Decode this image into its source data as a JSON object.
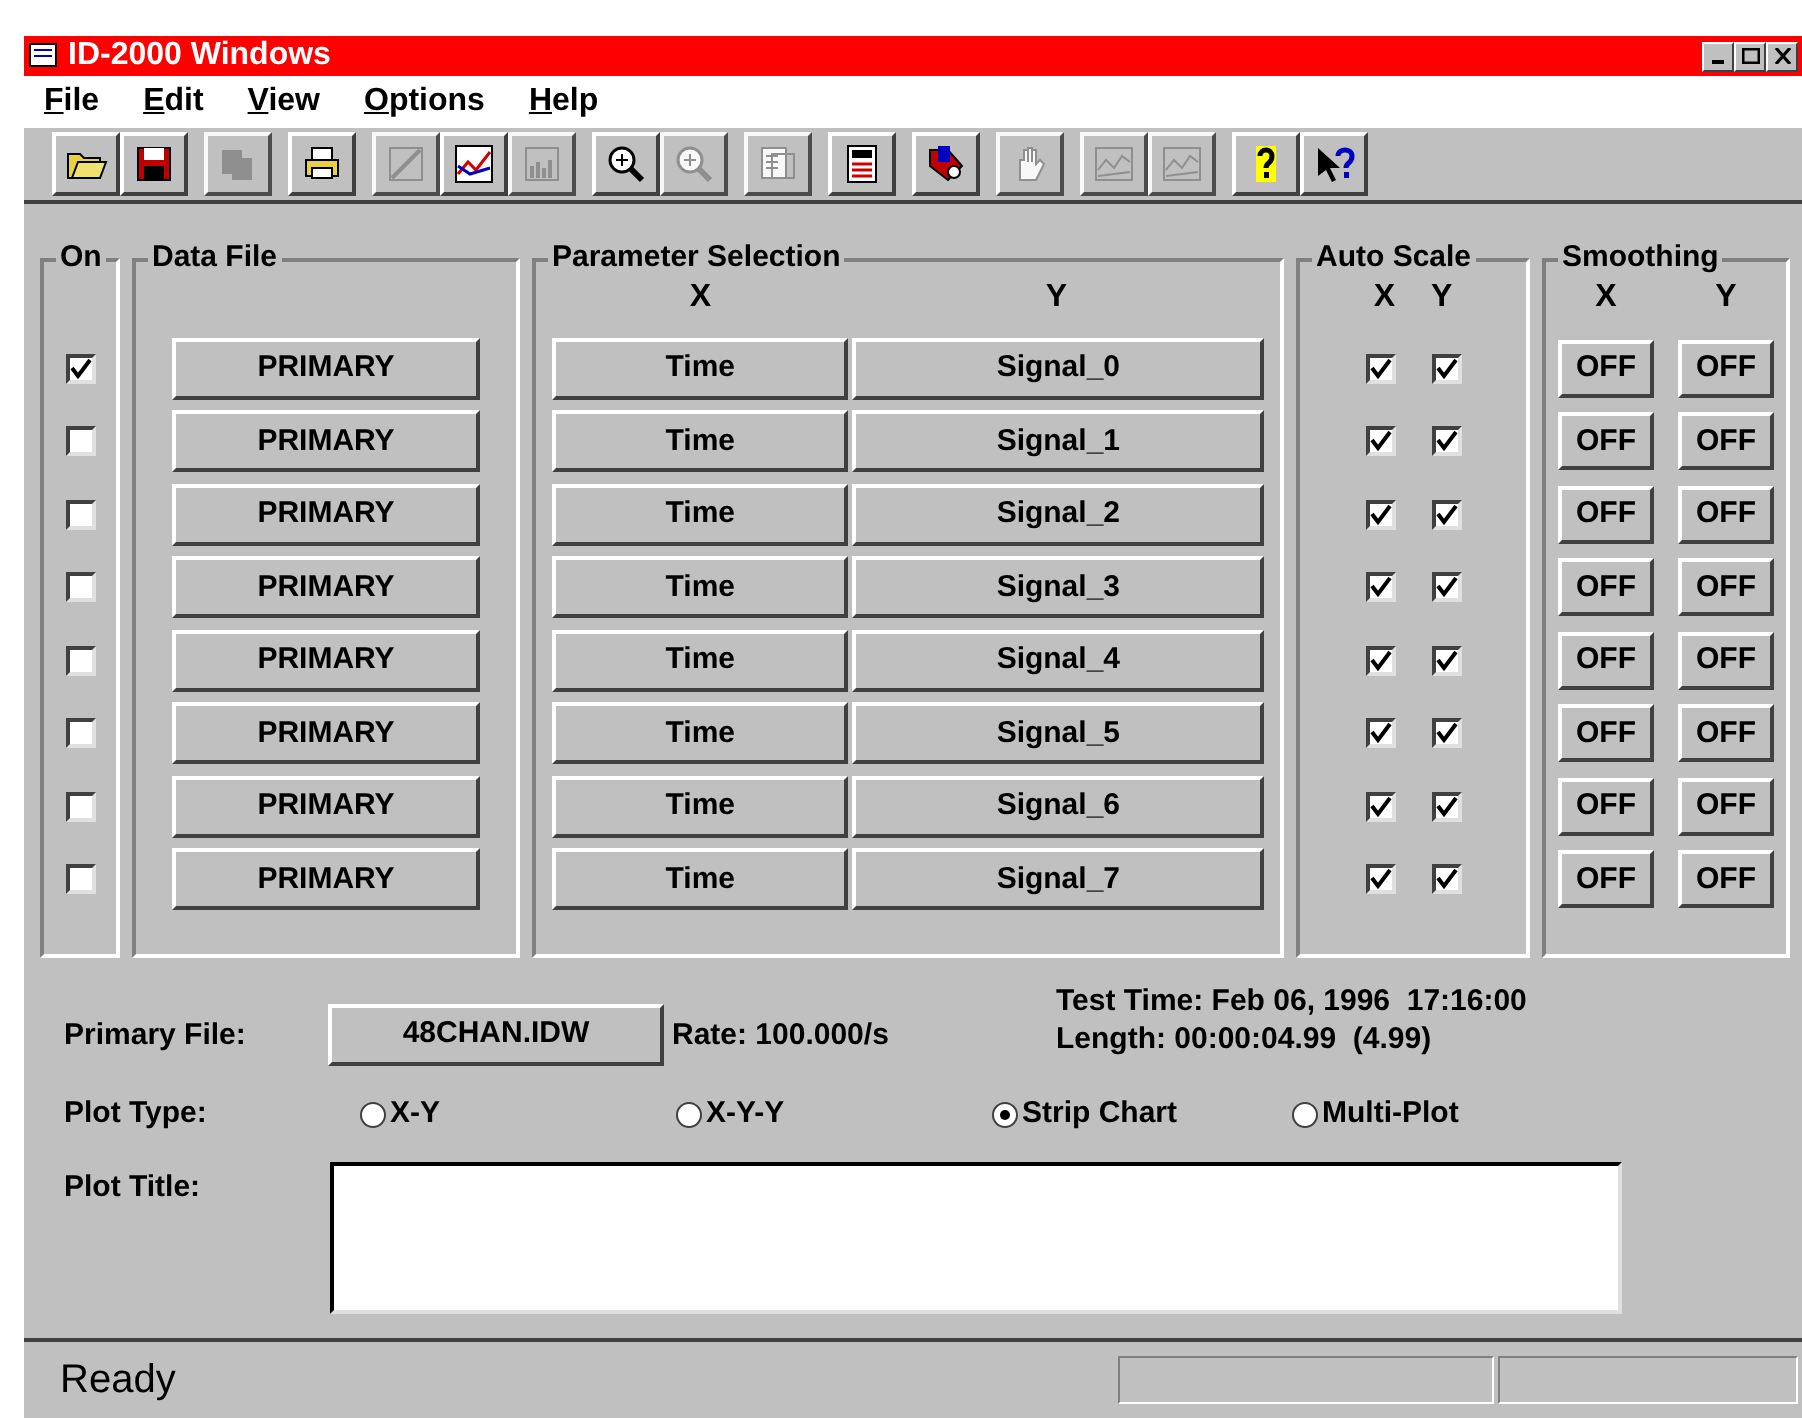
{
  "window": {
    "title": "ID-2000 Windows"
  },
  "menu": [
    {
      "label": "File"
    },
    {
      "label": "Edit"
    },
    {
      "label": "View"
    },
    {
      "label": "Options"
    },
    {
      "label": "Help"
    }
  ],
  "toolbar": [
    [
      {
        "kind": "open",
        "disabled": false
      },
      {
        "kind": "save",
        "disabled": false
      }
    ],
    [
      {
        "kind": "copy",
        "disabled": true
      }
    ],
    [
      {
        "kind": "print",
        "disabled": false
      }
    ],
    [
      {
        "kind": "scatter",
        "disabled": true
      },
      {
        "kind": "line",
        "disabled": false
      },
      {
        "kind": "bars",
        "disabled": true
      }
    ],
    [
      {
        "kind": "zoom",
        "disabled": false
      },
      {
        "kind": "zoom",
        "disabled": true
      }
    ],
    [
      {
        "kind": "report",
        "disabled": true
      }
    ],
    [
      {
        "kind": "calc",
        "disabled": false
      }
    ],
    [
      {
        "kind": "tag",
        "disabled": false
      }
    ],
    [
      {
        "kind": "hand",
        "disabled": true
      }
    ],
    [
      {
        "kind": "wave",
        "disabled": true
      },
      {
        "kind": "wave",
        "disabled": true
      }
    ],
    [
      {
        "kind": "help",
        "disabled": false
      },
      {
        "kind": "pointer",
        "disabled": false
      }
    ]
  ],
  "groups": {
    "on": "On",
    "data_file": "Data File",
    "parameter": "Parameter Selection",
    "auto_scale": "Auto Scale",
    "smoothing": "Smoothing"
  },
  "axis_headers": {
    "param_x": "X",
    "param_y": "Y",
    "auto_x": "X",
    "auto_y": "Y",
    "smooth_x": "X",
    "smooth_y": "Y"
  },
  "rows": [
    {
      "on": true,
      "data_file": "PRIMARY",
      "x": "Time",
      "y": "Signal_0",
      "auto_x": true,
      "auto_y": true,
      "smooth_x": "OFF",
      "smooth_y": "OFF"
    },
    {
      "on": false,
      "data_file": "PRIMARY",
      "x": "Time",
      "y": "Signal_1",
      "auto_x": true,
      "auto_y": true,
      "smooth_x": "OFF",
      "smooth_y": "OFF"
    },
    {
      "on": false,
      "data_file": "PRIMARY",
      "x": "Time",
      "y": "Signal_2",
      "auto_x": true,
      "auto_y": true,
      "smooth_x": "OFF",
      "smooth_y": "OFF"
    },
    {
      "on": false,
      "data_file": "PRIMARY",
      "x": "Time",
      "y": "Signal_3",
      "auto_x": true,
      "auto_y": true,
      "smooth_x": "OFF",
      "smooth_y": "OFF"
    },
    {
      "on": false,
      "data_file": "PRIMARY",
      "x": "Time",
      "y": "Signal_4",
      "auto_x": true,
      "auto_y": true,
      "smooth_x": "OFF",
      "smooth_y": "OFF"
    },
    {
      "on": false,
      "data_file": "PRIMARY",
      "x": "Time",
      "y": "Signal_5",
      "auto_x": true,
      "auto_y": true,
      "smooth_x": "OFF",
      "smooth_y": "OFF"
    },
    {
      "on": false,
      "data_file": "PRIMARY",
      "x": "Time",
      "y": "Signal_6",
      "auto_x": true,
      "auto_y": true,
      "smooth_x": "OFF",
      "smooth_y": "OFF"
    },
    {
      "on": false,
      "data_file": "PRIMARY",
      "x": "Time",
      "y": "Signal_7",
      "auto_x": true,
      "auto_y": true,
      "smooth_x": "OFF",
      "smooth_y": "OFF"
    }
  ],
  "primary_file": {
    "label": "Primary File:",
    "file": "48CHAN.IDW",
    "rate": "Rate: 100.000/s",
    "test_time": "Test Time: Feb 06, 1996  17:16:00",
    "length": "Length: 00:00:04.99  (4.99)"
  },
  "plot_type": {
    "label": "Plot Type:",
    "options": [
      {
        "label": "X-Y",
        "selected": false
      },
      {
        "label": "X-Y-Y",
        "selected": false
      },
      {
        "label": "Strip Chart",
        "selected": true
      },
      {
        "label": "Multi-Plot",
        "selected": false
      }
    ]
  },
  "plot_title": {
    "label": "Plot Title:"
  },
  "status_bar": {
    "text": "Ready"
  }
}
